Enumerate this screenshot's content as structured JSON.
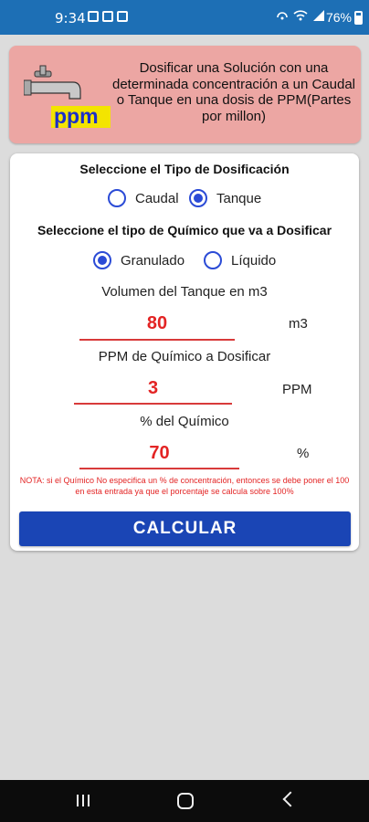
{
  "status_bar": {
    "time": "9:34",
    "battery": "76%"
  },
  "banner": {
    "logo_text": "ppm",
    "description": "Dosificar una Solución con una determinada concentración a un Caudal o Tanque en una dosis de PPM(Partes por millon)"
  },
  "form": {
    "dosing_type_title": "Seleccione el Tipo de Dosificación",
    "dosing_options": [
      {
        "label": "Caudal",
        "selected": false
      },
      {
        "label": "Tanque",
        "selected": true
      }
    ],
    "chemical_type_title": "Seleccione el tipo de Químico que va a Dosificar",
    "chemical_options": [
      {
        "label": "Granulado",
        "selected": true
      },
      {
        "label": "Líquido",
        "selected": false
      }
    ],
    "fields": [
      {
        "label": "Volumen del Tanque en m3",
        "value": "80",
        "unit": "m3"
      },
      {
        "label": "PPM de Químico a Dosificar",
        "value": "3",
        "unit": "PPM"
      },
      {
        "label": "% del Químico",
        "value": "70",
        "unit": "%"
      }
    ],
    "note": "NOTA: si el Químico No especifica un % de concentración, entonces se debe poner el 100 en esta entrada ya que el porcentaje se calcula sobre 100%",
    "calculate_label": "CALCULAR"
  },
  "colors": {
    "status_bar": "#1d6fb5",
    "banner": "#eca6a3",
    "accent": "#2b4bd6",
    "value_red": "#e32424",
    "button": "#1a45b5"
  }
}
